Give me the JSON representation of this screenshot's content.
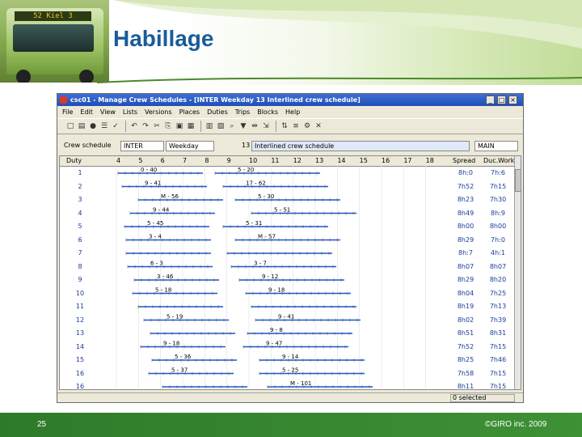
{
  "slide": {
    "title": "Habillage",
    "page_number": "25",
    "copyright": "©GIRO inc. 2009",
    "bus_sign": "52 Kiel 3"
  },
  "window": {
    "title": "csc01 - Manage Crew Schedules - [INTER Weekday 13 Interlined crew schedule]",
    "controls": [
      "_",
      "□",
      "×"
    ]
  },
  "menu": [
    "File",
    "Edit",
    "View",
    "Lists",
    "Versions",
    "Places",
    "Duties",
    "Trips",
    "Blocks",
    "Help"
  ],
  "toolbar_icons": [
    "new-icon",
    "open-icon",
    "info-icon",
    "list-icon",
    "check-icon",
    "undo-icon",
    "redo-icon",
    "cut-icon",
    "copy-icon",
    "paste-icon",
    "grid-icon",
    "calc-icon",
    "chart-icon",
    "search-icon",
    "filter-icon",
    "split-icon",
    "merge-icon",
    "sort-icon",
    "align-icon",
    "tools-icon",
    "close-icon"
  ],
  "crew_schedule": {
    "label": "Crew schedule",
    "scenario": "INTER",
    "day": "Weekday",
    "number": "13",
    "description": "Interlined crew schedule",
    "branch": "MAIN"
  },
  "grid": {
    "duty_header": "Duty",
    "hours": [
      "4",
      "5",
      "6",
      "7",
      "8",
      "9",
      "10",
      "11",
      "12",
      "13",
      "14",
      "15",
      "16",
      "17",
      "18"
    ],
    "spread_header": "Spread",
    "work_header": "Duc.Work",
    "rows": [
      {
        "duty": "1",
        "spread": "8h:0",
        "work": "7h:6",
        "labels": [
          "0 - 40",
          "5 - 20"
        ]
      },
      {
        "duty": "2",
        "spread": "7h52",
        "work": "7h15",
        "labels": [
          "9 - 41",
          "17 - 62"
        ]
      },
      {
        "duty": "3",
        "spread": "8h23",
        "work": "7h30",
        "labels": [
          "M - 56",
          "5 - 30"
        ]
      },
      {
        "duty": "4",
        "spread": "8h49",
        "work": "8h:9",
        "labels": [
          "9 - 44",
          "5 - 51"
        ]
      },
      {
        "duty": "5",
        "spread": "8h00",
        "work": "8h00",
        "labels": [
          "5 - 45",
          "5 - 31"
        ]
      },
      {
        "duty": "6",
        "spread": "8h29",
        "work": "7h:0",
        "labels": [
          "3 - 4",
          "M - 57"
        ]
      },
      {
        "duty": "7",
        "spread": "8h:7",
        "work": "4h:1",
        "labels": [
          "",
          ""
        ]
      },
      {
        "duty": "8",
        "spread": "8h07",
        "work": "8h07",
        "labels": [
          "6 - 3",
          "3 - 7"
        ]
      },
      {
        "duty": "9",
        "spread": "8h29",
        "work": "8h20",
        "labels": [
          "3 - 46",
          "9 - 12"
        ]
      },
      {
        "duty": "10",
        "spread": "8h04",
        "work": "7h25",
        "labels": [
          "5 - 18",
          "9 - 18"
        ]
      },
      {
        "duty": "11",
        "spread": "8h19",
        "work": "7h13",
        "labels": [
          "",
          ""
        ]
      },
      {
        "duty": "12",
        "spread": "8h02",
        "work": "7h39",
        "labels": [
          "5 - 19",
          "9 - 41"
        ]
      },
      {
        "duty": "13",
        "spread": "8h51",
        "work": "8h31",
        "labels": [
          "",
          "9 - 8"
        ]
      },
      {
        "duty": "14",
        "spread": "7h52",
        "work": "7h15",
        "labels": [
          "9 - 18",
          "9 - 47"
        ]
      },
      {
        "duty": "15",
        "spread": "8h25",
        "work": "7h46",
        "labels": [
          "5 - 36",
          "9 - 14"
        ]
      },
      {
        "duty": "16",
        "spread": "7h58",
        "work": "7h15",
        "labels": [
          "5 - 37",
          "5 - 25"
        ]
      },
      {
        "duty": "16",
        "spread": "8h11",
        "work": "7h15",
        "labels": [
          "",
          "M - 101"
        ]
      }
    ]
  },
  "status": {
    "selection": "0 selected"
  },
  "colors": {
    "title_blue": "#1a5c9a",
    "footer_green": "#2f7a2a",
    "bar_blue": "#1f55c8",
    "titlebar_blue": "#1f4fb5"
  }
}
